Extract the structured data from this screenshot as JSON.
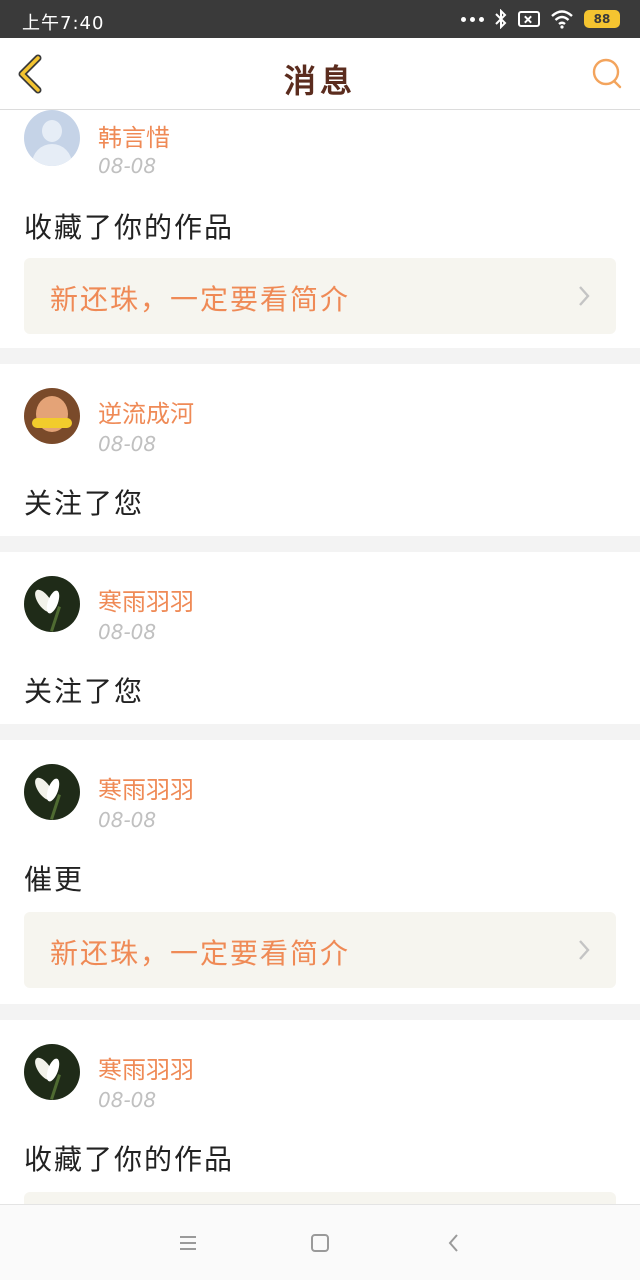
{
  "status_bar": {
    "time": "上午7:40",
    "battery": "88",
    "icons": [
      "more-dots-icon",
      "bluetooth-icon",
      "sim-x-icon",
      "wifi-icon",
      "battery-icon"
    ]
  },
  "header": {
    "title": "消息",
    "back_icon": "back-chevron-icon",
    "search_icon": "search-icon"
  },
  "colors": {
    "accent": "#ef8a56",
    "title": "#5b2c1e",
    "back": "#f4c430",
    "card_bg": "#f6f5ef"
  },
  "messages": [
    {
      "user": "韩言惜",
      "date": "08-08",
      "action": "收藏了你的作品",
      "work_title": "新还珠，一定要看简介"
    },
    {
      "user": "逆流成河",
      "date": "08-08",
      "action": "关注了您"
    },
    {
      "user": "寒雨羽羽",
      "date": "08-08",
      "action": "关注了您"
    },
    {
      "user": "寒雨羽羽",
      "date": "08-08",
      "action": "催更",
      "work_title": "新还珠，一定要看简介"
    },
    {
      "user": "寒雨羽羽",
      "date": "08-08",
      "action": "收藏了你的作品"
    }
  ],
  "nav": {
    "icons": [
      "menu-icon",
      "home-square-icon",
      "back-triangle-icon"
    ]
  }
}
